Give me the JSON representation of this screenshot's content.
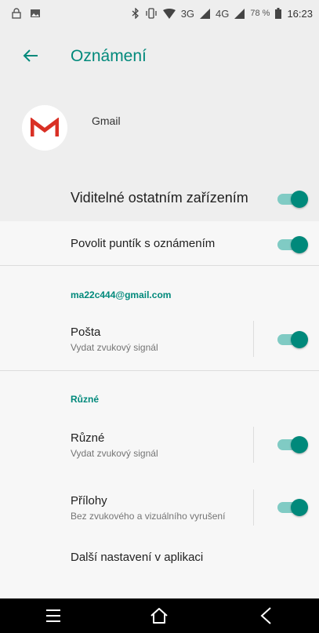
{
  "status_bar": {
    "network_3g": "3G",
    "network_4g": "4G",
    "battery_percent": "78 %",
    "time": "16:23",
    "icons": [
      "lock-icon",
      "image-icon",
      "bluetooth-icon",
      "vibrate-icon",
      "wifi-icon",
      "signal-icon",
      "battery-icon"
    ]
  },
  "app_bar": {
    "title": "Oznámení"
  },
  "app": {
    "name": "Gmail",
    "icon": "gmail-icon",
    "brand_color": "#d93025"
  },
  "master": {
    "label": "Viditelné ostatním zařízením",
    "enabled": true
  },
  "badge_row": {
    "label": "Povolit puntík s oznámením",
    "enabled": true
  },
  "sections": {
    "account": "ma22c444@gmail.com",
    "misc": "Různé"
  },
  "channels": {
    "posta": {
      "title": "Pošta",
      "subtitle": "Vydat zvukový signál",
      "enabled": true
    },
    "ruzne": {
      "title": "Různé",
      "subtitle": "Vydat zvukový signál",
      "enabled": true
    },
    "prilohy": {
      "title": "Přílohy",
      "subtitle": "Bez zvukového a vizuálního vyrušení",
      "enabled": true
    }
  },
  "more_settings": {
    "label": "Další nastavení v aplikaci"
  },
  "colors": {
    "accent": "#00897b",
    "toggle_track": "#80cbc4"
  },
  "nav_bar": {
    "icons": [
      "menu-icon",
      "home-icon",
      "back-icon"
    ]
  }
}
